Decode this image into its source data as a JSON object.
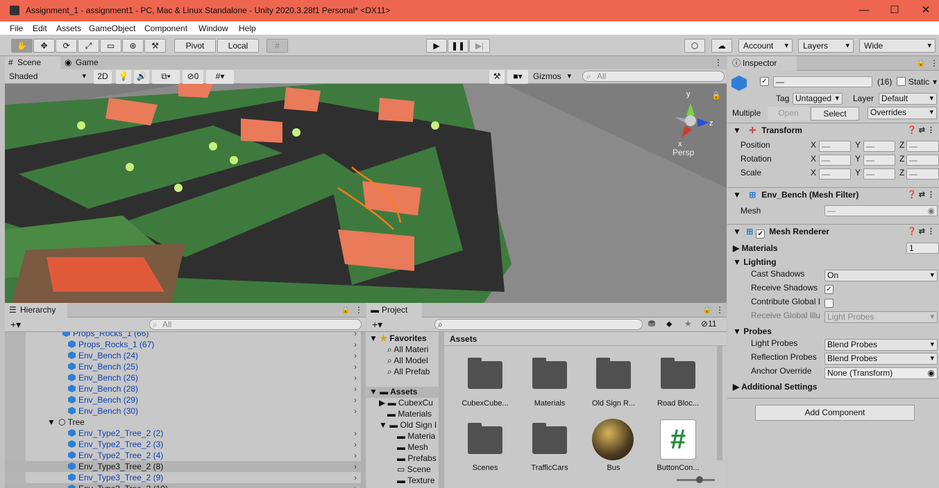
{
  "window": {
    "title": "Assignment_1 - assignment1 - PC, Mac & Linux Standalone - Unity 2020.3.28f1 Personal* <DX11>",
    "minimize": "—",
    "maximize": "☐",
    "close": "✕"
  },
  "menu": [
    "File",
    "Edit",
    "Assets",
    "GameObject",
    "Component",
    "Window",
    "Help"
  ],
  "toolbar": {
    "pivot": "Pivot",
    "local": "Local",
    "account": "Account",
    "layers": "Layers",
    "layout": "Wide"
  },
  "scene": {
    "tab_scene": "Scene",
    "tab_game": "Game",
    "shading": "Shaded",
    "mode2d": "2D",
    "hidden_count": "0",
    "gizmos": "Gizmos",
    "search_placeholder": "All",
    "persp": "Persp"
  },
  "hierarchy": {
    "title": "Hierarchy",
    "search_placeholder": "All",
    "rows": [
      {
        "label": "Props_Rocks_1 (66)",
        "indent": 90,
        "blue": true,
        "cut": true
      },
      {
        "label": "Props_Rocks_1 (67)",
        "indent": 98,
        "blue": true
      },
      {
        "label": "Env_Bench (24)",
        "indent": 98,
        "blue": true
      },
      {
        "label": "Env_Bench (25)",
        "indent": 98,
        "blue": true
      },
      {
        "label": "Env_Bench (26)",
        "indent": 98,
        "blue": true
      },
      {
        "label": "Env_Bench (28)",
        "indent": 98,
        "blue": true
      },
      {
        "label": "Env_Bench (29)",
        "indent": 98,
        "blue": true
      },
      {
        "label": "Env_Bench (30)",
        "indent": 98,
        "blue": true
      },
      {
        "label": "Tree",
        "indent": 84,
        "blue": false,
        "folder": true
      },
      {
        "label": "Env_Type2_Tree_2 (2)",
        "indent": 98,
        "blue": true
      },
      {
        "label": "Env_Type2_Tree_2 (3)",
        "indent": 98,
        "blue": true
      },
      {
        "label": "Env_Type2_Tree_2 (4)",
        "indent": 98,
        "blue": true
      },
      {
        "label": "Env_Type3_Tree_2 (8)",
        "indent": 98,
        "blue": false,
        "selected": true
      },
      {
        "label": "Env_Type3_Tree_2 (9)",
        "indent": 98,
        "blue": true
      },
      {
        "label": "Env_Type3_Tree_2 (10)",
        "indent": 98,
        "blue": false,
        "selected": true
      }
    ]
  },
  "project": {
    "title": "Project",
    "hidden_count": "11",
    "favorites_label": "Favorites",
    "favorites": [
      "All Materi",
      "All Model",
      "All Prefab"
    ],
    "assets_label": "Assets",
    "tree": [
      "CubexCu",
      "Materials",
      "Old Sign I",
      "Materia",
      "Mesh",
      "Prefabs",
      "Scene",
      "Texture"
    ],
    "breadcrumb": "Assets",
    "grid": [
      {
        "label": "CubexCube...",
        "kind": "folder"
      },
      {
        "label": "Materials",
        "kind": "folder"
      },
      {
        "label": "Old Sign R...",
        "kind": "folder"
      },
      {
        "label": "Road Bloc...",
        "kind": "folder"
      },
      {
        "label": "Scenes",
        "kind": "folder"
      },
      {
        "label": "TrafficCars",
        "kind": "folder"
      },
      {
        "label": "Bus",
        "kind": "material"
      },
      {
        "label": "ButtonCon...",
        "kind": "script"
      }
    ]
  },
  "inspector": {
    "title": "Inspector",
    "name_value": "—",
    "count": "(16)",
    "static": "Static",
    "tag_label": "Tag",
    "tag_value": "Untagged",
    "layer_label": "Layer",
    "layer_value": "Default",
    "multiple": "Multiple",
    "open": "Open",
    "select": "Select",
    "overrides": "Overrides",
    "transform": {
      "title": "Transform",
      "rows": [
        "Position",
        "Rotation",
        "Scale"
      ],
      "x": "X",
      "y": "Y",
      "z": "Z",
      "dash": "—"
    },
    "meshfilter": {
      "title": "Env_Bench (Mesh Filter)",
      "mesh_label": "Mesh",
      "mesh_value": "—"
    },
    "renderer": {
      "title": "Mesh Renderer",
      "materials": "Materials",
      "materials_count": "1",
      "lighting": "Lighting",
      "cast_shadows": "Cast Shadows",
      "cast_value": "On",
      "receive_shadows": "Receive Shadows",
      "contribute": "Contribute Global I",
      "receive_gi": "Receive Global Illu",
      "receive_gi_value": "Light Probes",
      "probes": "Probes",
      "light_probes": "Light Probes",
      "light_probes_value": "Blend Probes",
      "reflection_probes": "Reflection Probes",
      "reflection_value": "Blend Probes",
      "anchor": "Anchor Override",
      "anchor_value": "None (Transform)",
      "additional": "Additional Settings"
    },
    "add_component": "Add Component"
  }
}
